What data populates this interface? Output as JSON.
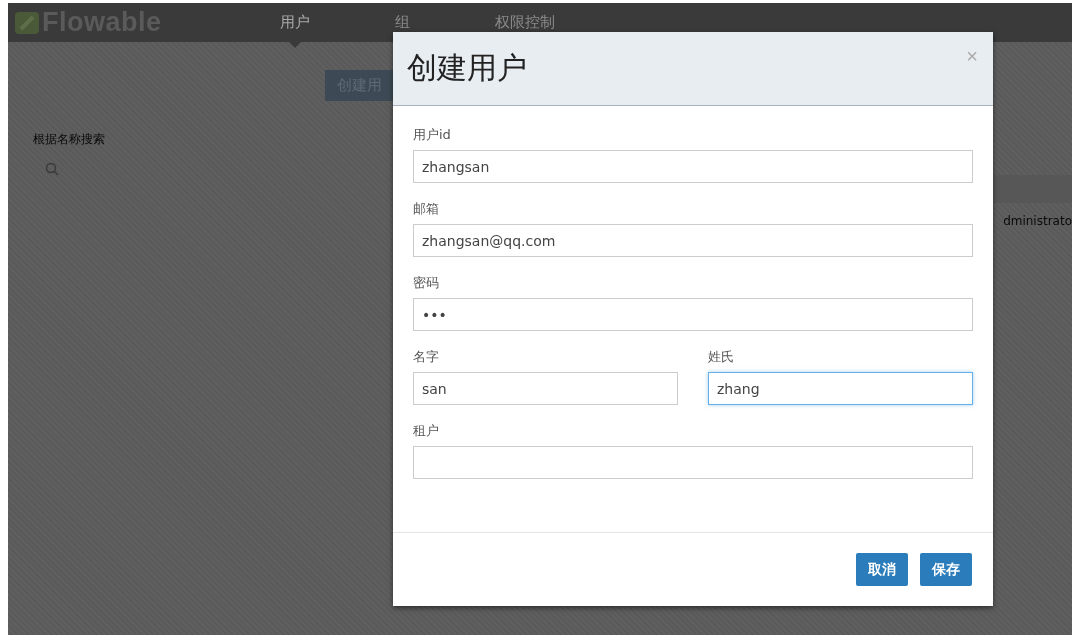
{
  "nav": {
    "logo": "Flowable",
    "tabs": [
      {
        "label": "用户",
        "selected": true
      },
      {
        "label": "组",
        "selected": false
      },
      {
        "label": "权限控制",
        "selected": false
      }
    ]
  },
  "page": {
    "create_button": "创建用",
    "search_label": "根据名称搜索",
    "table_cell": "dministrato"
  },
  "dialog": {
    "title": "创建用户",
    "close": "×",
    "rows": [
      {
        "fields": [
          {
            "label": "用户id",
            "value": "zhangsan",
            "focused": false
          }
        ]
      },
      {
        "fields": [
          {
            "label": "邮箱",
            "value": "zhangsan@qq.com",
            "focused": false
          }
        ]
      },
      {
        "fields": [
          {
            "label": "密码",
            "value": "•••",
            "focused": false
          }
        ]
      },
      {
        "fields": [
          {
            "label": "名字",
            "value": "san",
            "focused": false
          },
          {
            "label": "姓氏",
            "value": "zhang",
            "focused": true
          }
        ]
      },
      {
        "fields": [
          {
            "label": "租户",
            "focused": false
          }
        ]
      }
    ],
    "buttons": [
      {
        "label": "取消"
      },
      {
        "label": "保存"
      }
    ]
  }
}
